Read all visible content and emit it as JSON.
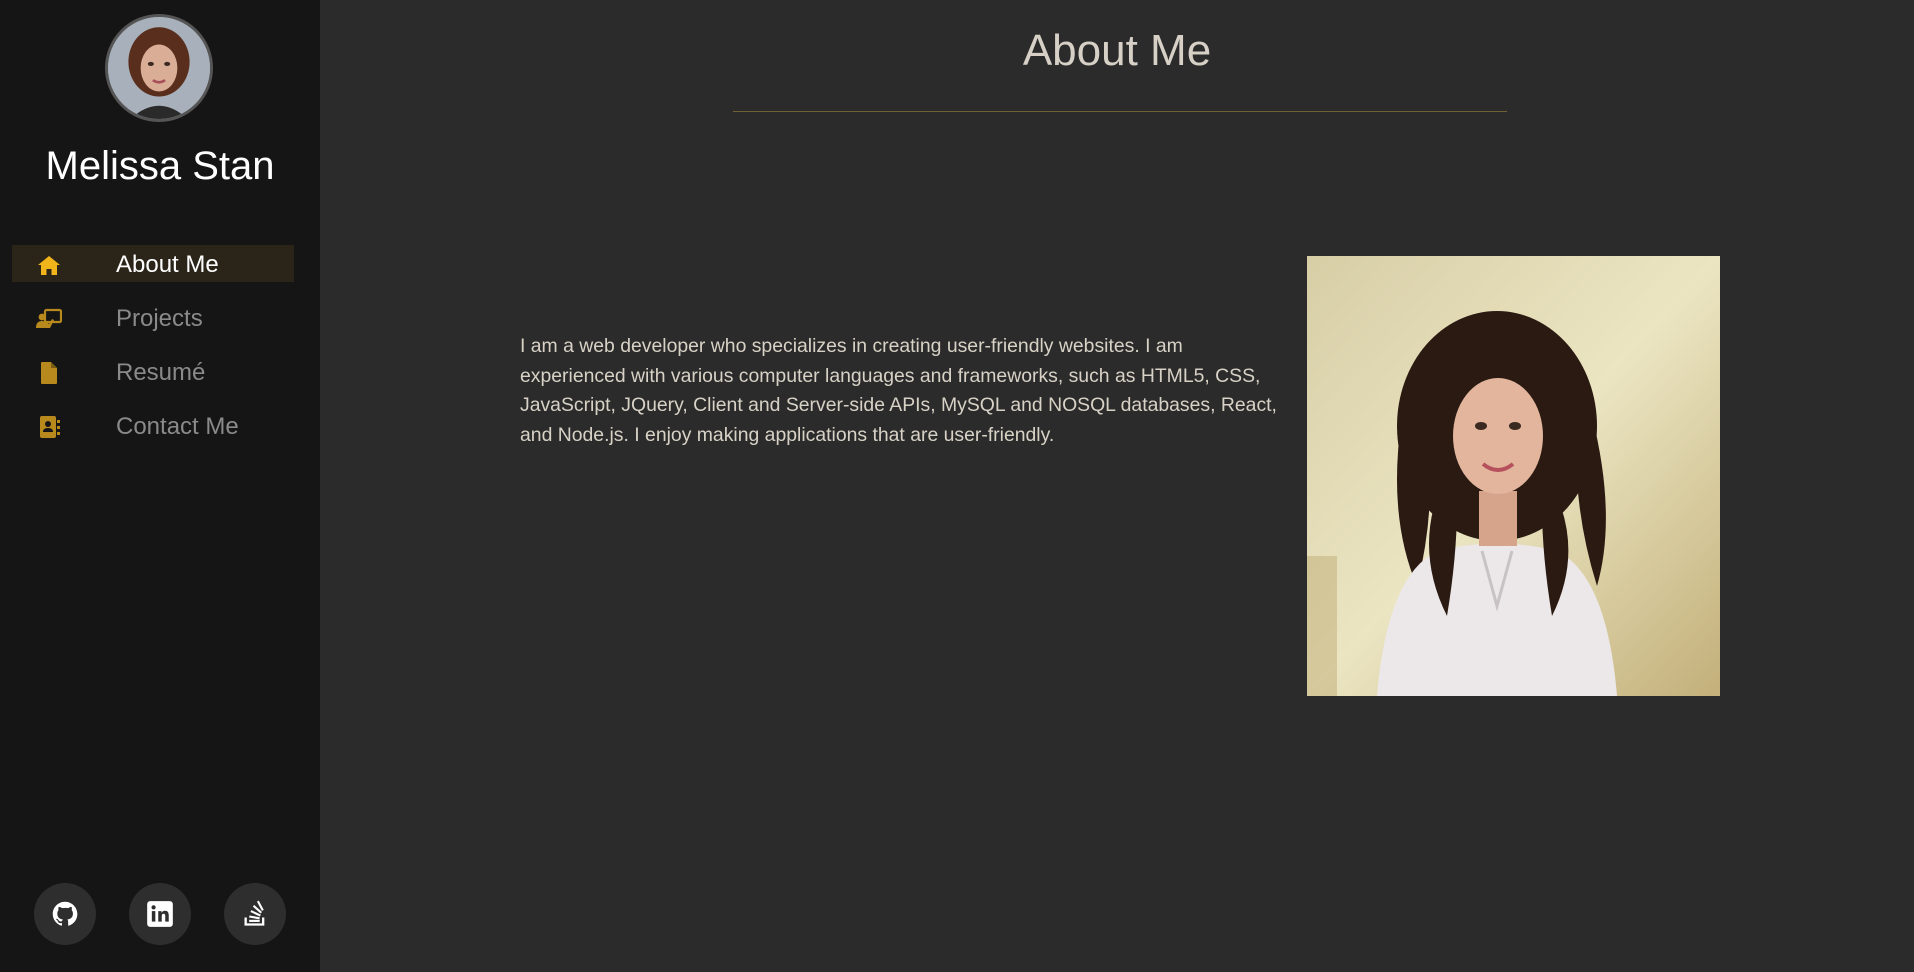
{
  "sidebar": {
    "name": "Melissa Stan",
    "avatar_icon": "profile-avatar",
    "nav": [
      {
        "label": "About Me",
        "icon": "home-icon",
        "active": true
      },
      {
        "label": "Projects",
        "icon": "presentation-icon",
        "active": false
      },
      {
        "label": "Resumé",
        "icon": "file-icon",
        "active": false
      },
      {
        "label": "Contact Me",
        "icon": "contact-book-icon",
        "active": false
      }
    ],
    "socials": [
      {
        "icon": "github-icon"
      },
      {
        "icon": "linkedin-icon"
      },
      {
        "icon": "stack-overflow-icon"
      }
    ]
  },
  "main": {
    "title": "About Me",
    "bio": "I am a web developer who specializes in creating user-friendly websites. I am experienced with various computer languages and frameworks, such as HTML5, CSS, JavaScript, JQuery, Client and Server-side APIs, MySQL and NOSQL databases, React, and Node.js. I enjoy making applications that are user-friendly."
  },
  "colors": {
    "accent": "#f2b41b",
    "sidebar_bg": "#151515",
    "main_bg": "#2b2b2b",
    "active_nav_bg": "#2b2519"
  }
}
